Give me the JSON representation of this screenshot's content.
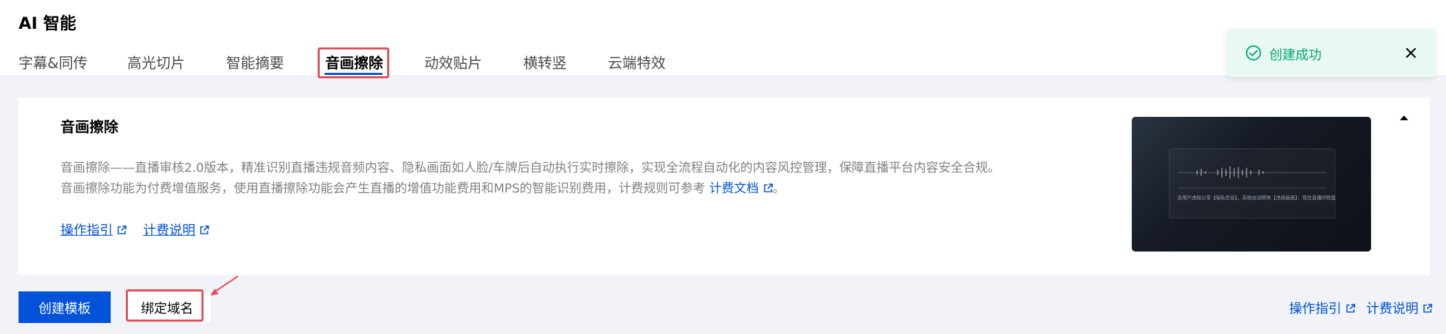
{
  "header": {
    "title": "AI 智能"
  },
  "tabs": [
    {
      "label": "字幕&同传"
    },
    {
      "label": "高光切片"
    },
    {
      "label": "智能摘要"
    },
    {
      "label": "音画擦除"
    },
    {
      "label": "动效贴片"
    },
    {
      "label": "横转竖"
    },
    {
      "label": "云端特效"
    }
  ],
  "active_tab_index": 3,
  "toast": {
    "message": "创建成功",
    "icon": "check-circle-icon",
    "color": "#00a870"
  },
  "intro": {
    "title": "音画擦除",
    "desc_line1": "音画擦除——直播审核2.0版本，精准识别直播违规音频内容、隐私画面如人脸/车牌后自动执行实时擦除，实现全流程自动化的内容风控管理，保障直播平台内容安全合规。",
    "desc_line2_prefix": "音画擦除功能为付费增值服务，使用直播擦除功能会产生直播的增值功能费用和MPS的智能识别费用，计费规则可参考",
    "desc_line2_link": "计费文档",
    "desc_line2_suffix": "。",
    "link_guide": "操作指引",
    "link_billing": "计费说明",
    "preview_caption": "该用户违规分享【隐私信息】，系统自动擦除【违规画面】，现在直播间恢复"
  },
  "actions": {
    "create_template": "创建模板",
    "bind_domain": "绑定域名",
    "guide": "操作指引",
    "billing": "计费说明"
  },
  "colors": {
    "primary": "#0052d9",
    "highlight": "#e34d59",
    "success": "#00a870"
  }
}
